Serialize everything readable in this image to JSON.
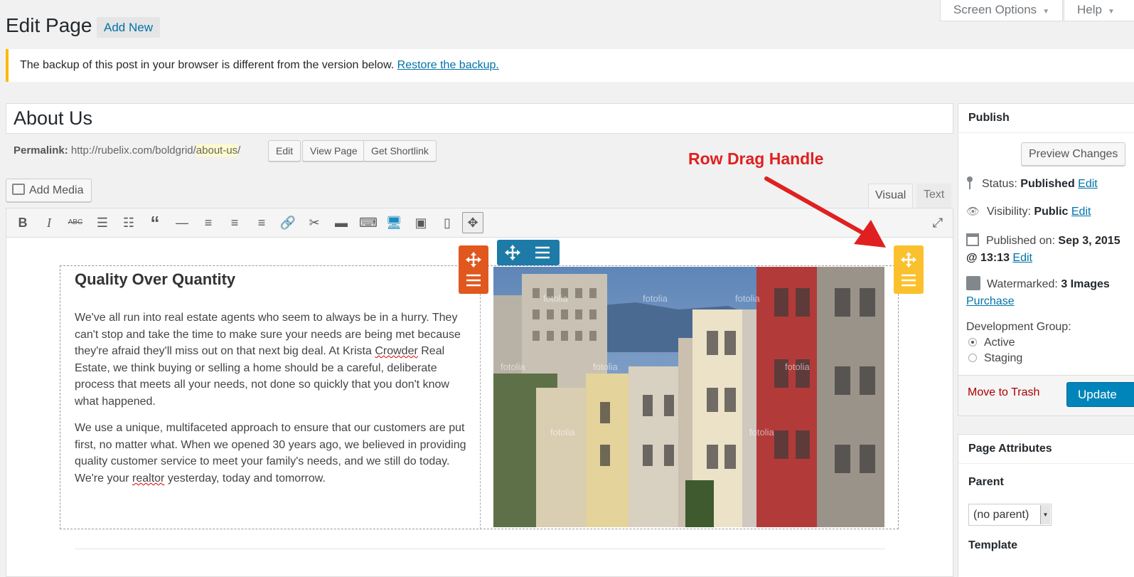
{
  "header": {
    "title": "Edit Page",
    "add_new": "Add New",
    "screen_options": "Screen Options",
    "help": "Help"
  },
  "notice": {
    "text": "The backup of this post in your browser is different from the version below.",
    "link": "Restore the backup."
  },
  "post": {
    "title": "About Us",
    "permalink_label": "Permalink:",
    "permalink_base": "http://rubelix.com/boldgrid/",
    "permalink_slug": "about-us",
    "permalink_tail": "/",
    "edit_btn": "Edit",
    "view_btn": "View Page",
    "shortlink_btn": "Get Shortlink"
  },
  "editor": {
    "add_media": "Add Media",
    "tab_visual": "Visual",
    "tab_text": "Text",
    "heading": "Quality Over Quantity",
    "p1_a": "We've all run into real estate agents who seem to always be in a hurry. They can't stop and take the time to make sure your needs are being met because they're afraid they'll miss out on that next big deal. At Krista ",
    "p1_b": "Crowder",
    "p1_c": " Real Estate, we think buying or selling a home should be a careful, deliberate process that meets all your needs, not done so quickly that you don't know what happened.",
    "p2_a": "We use a unique, multifaceted approach to ensure that our customers are put first, no matter what. When we opened 30 years ago, we believed in providing quality customer service to meet your family's needs, and we still do today. We're your ",
    "p2_b": "realtor",
    "p2_c": " yesterday, today and tomorrow.",
    "watermark": "fotolia"
  },
  "annotation": "Row Drag Handle",
  "publish": {
    "title": "Publish",
    "preview": "Preview Changes",
    "status_label": "Status:",
    "status_value": "Published",
    "visibility_label": "Visibility:",
    "visibility_value": "Public",
    "published_label": "Published on:",
    "published_value": "Sep 3, 2015",
    "published_time": "@ 13:13",
    "edit": "Edit",
    "watermarked_label": "Watermarked:",
    "watermarked_value": "3 Images",
    "purchase": "Purchase",
    "dev_group": "Development Group:",
    "active": "Active",
    "staging": "Staging",
    "trash": "Move to Trash",
    "update": "Update"
  },
  "attributes": {
    "title": "Page Attributes",
    "parent": "Parent",
    "parent_value": "(no parent)",
    "template": "Template"
  },
  "colors": {
    "accent": "#0073aa",
    "orange_handle": "#e0581d",
    "blue_handle": "#1e7aa7",
    "yellow_handle": "#fbc02d",
    "annotation": "#e02020",
    "update_button": "#0085ba"
  }
}
